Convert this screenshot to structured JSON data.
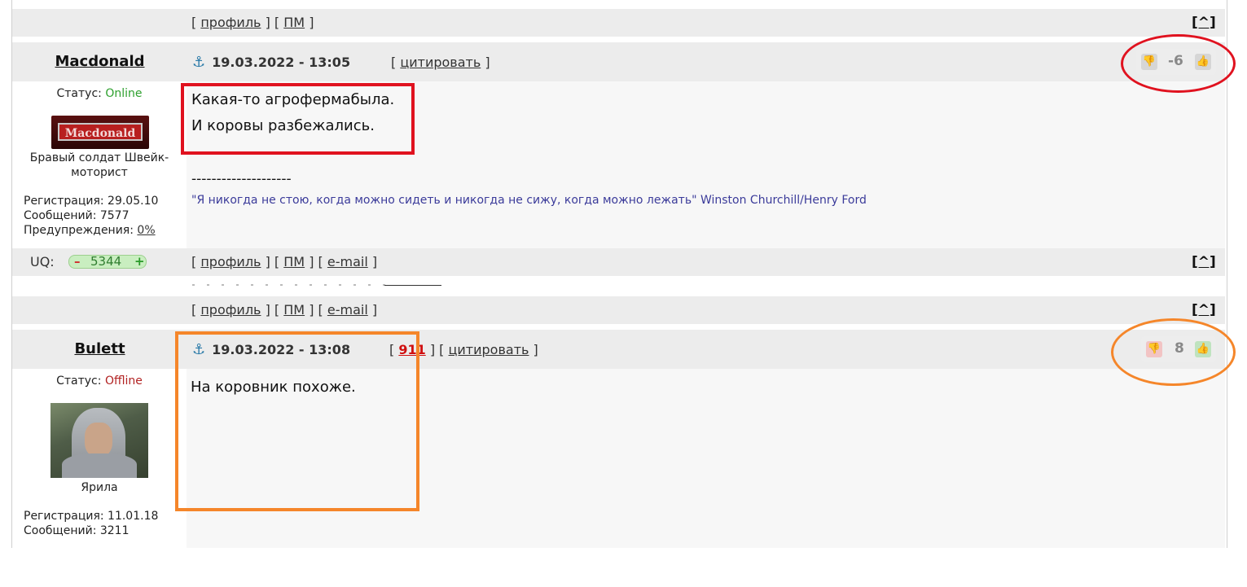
{
  "nav": {
    "open_bracket": "[",
    "sep": "] [",
    "close_bracket": "]",
    "profile": "профиль",
    "pm": "ПМ",
    "email": "e-mail",
    "top": "[^]"
  },
  "posts": [
    {
      "author": "Macdonald",
      "status_label": "Статус:",
      "status_value": "Online",
      "status_color": "#2ea02e",
      "avatar_text": "Macdonald",
      "user_title": "Бравый солдат Швейк-моторист",
      "registration": "Регистрация: 29.05.10",
      "messages": "Сообщений: 7577",
      "warnings_label": "Предупреждения:",
      "warnings_value": "0%",
      "date": "19.03.2022 - 13:05",
      "quote_label": "цитировать",
      "body_lines": [
        "Какая-то агрофермабыла.",
        "И коровы разбежались."
      ],
      "sig_divider": "--------------------",
      "signature": "\"Я никогда не стою, когда можно сидеть и никогда не сижу, когда можно лежать\" Winston Churchill/Henry Ford",
      "vote_score": "-6",
      "uq_label": "UQ:",
      "uq_value": "5344",
      "uq_minus": "–",
      "uq_plus": "+"
    },
    {
      "author": "Bulett",
      "status_label": "Статус:",
      "status_value": "Offline",
      "status_color": "#b22222",
      "user_title": "Ярила",
      "registration": "Регистрация: 11.01.18",
      "messages": "Сообщений: 3211",
      "date": "19.03.2022 - 13:08",
      "reply_ref": "911",
      "quote_label": "цитировать",
      "body_lines": [
        "На коровник похоже."
      ],
      "vote_score": "8"
    }
  ],
  "annotations": {
    "red_color": "#e0121f",
    "orange_color": "#f5862a"
  }
}
